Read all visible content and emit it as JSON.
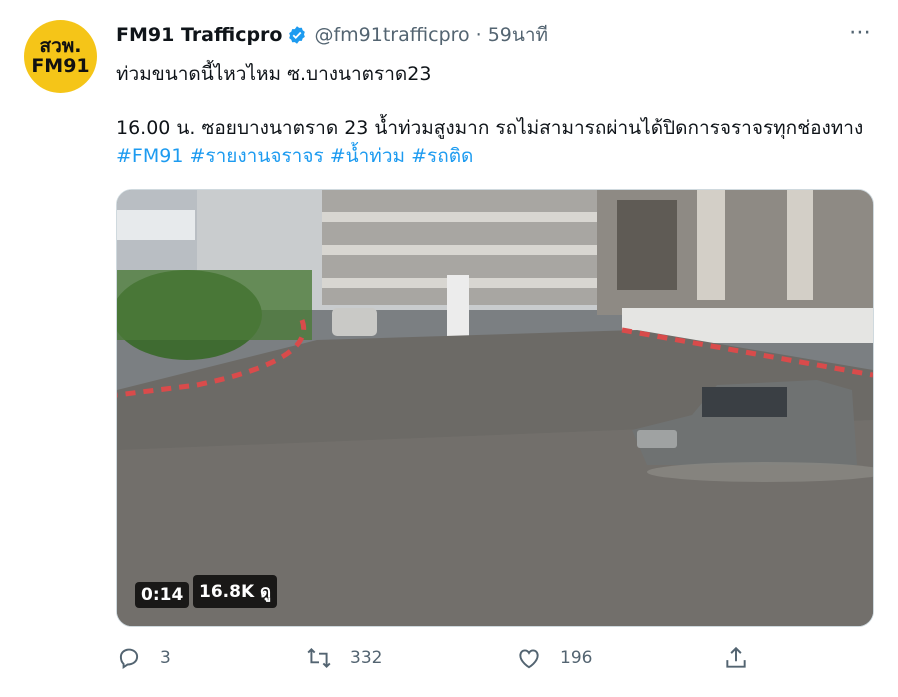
{
  "avatar": {
    "line1": "สวพ.",
    "line2": "FM91"
  },
  "header": {
    "name": "FM91 Trafficpro",
    "handle": "@fm91trafficpro",
    "separator": "·",
    "time": "59นาที",
    "more_icon": "⋯"
  },
  "tweet": {
    "line1": "ท่วมขนาดนี้ไหวไหม ซ.บางนาตราด23",
    "body_part1": "16.00 น. ซอยบางนาตราด 23 น้ำท่วมสูงมาก รถไม่สามารถผ่านได้ปิดการจราจรทุกช่องทาง",
    "hashtags": [
      "#FM91",
      "#รายงานจราจร",
      "#น้ำท่วม",
      "#รถติด"
    ]
  },
  "media": {
    "duration": "0:14",
    "views": "16.8K ดู"
  },
  "actions": {
    "replies": "3",
    "retweets": "332",
    "likes": "196"
  },
  "colors": {
    "accent": "#1d9bf0",
    "muted": "#536471",
    "avatar_bg": "#f5c518"
  }
}
